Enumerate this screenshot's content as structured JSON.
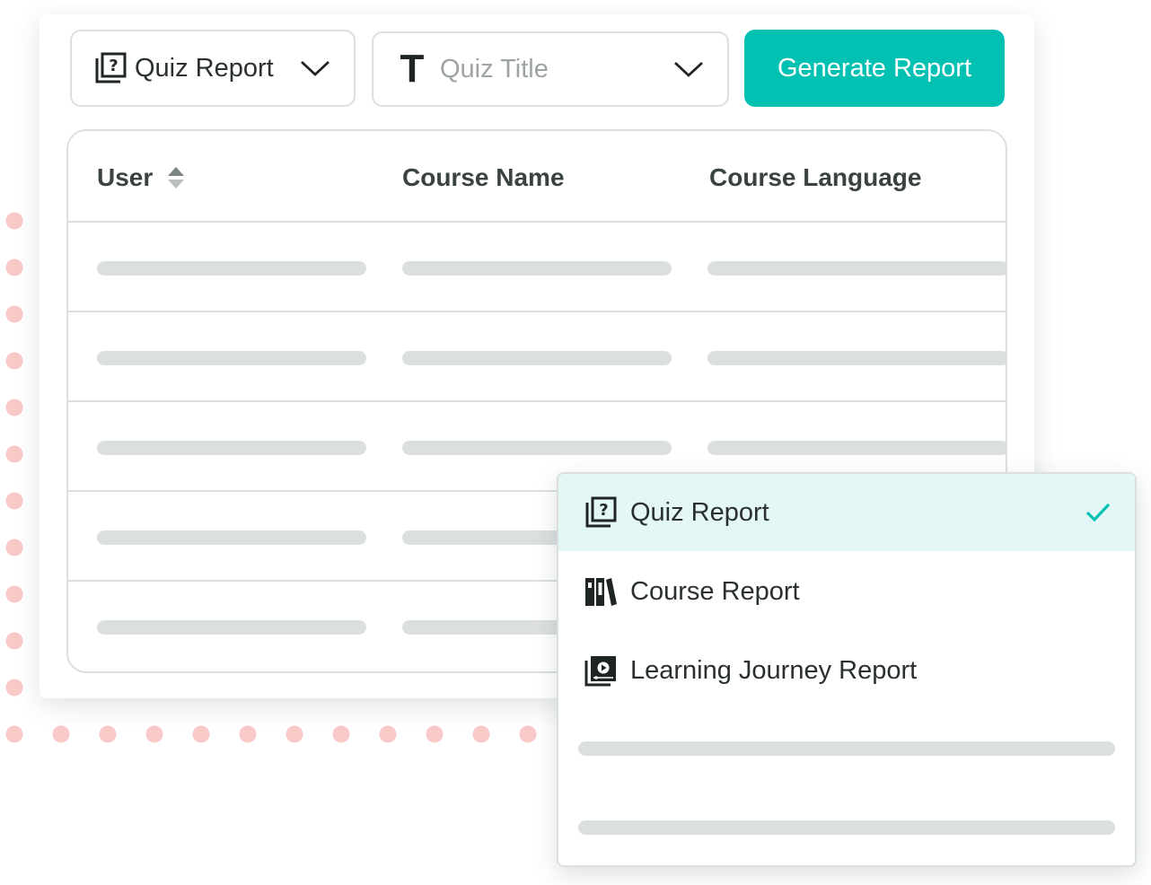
{
  "colors": {
    "accent": "#03c1b2",
    "selected_bg": "#e3f7f6",
    "dot": "#f9c9c8",
    "border": "#dcdfe0",
    "skeleton": "#dcdfe0"
  },
  "toolbar": {
    "report_type": {
      "icon": "quiz-report-icon",
      "value": "Quiz Report"
    },
    "quiz_title": {
      "icon": "text-icon",
      "placeholder": "Quiz Title"
    },
    "generate_label": "Generate Report"
  },
  "table": {
    "columns": [
      {
        "label": "User",
        "sortable": true
      },
      {
        "label": "Course Name",
        "sortable": false
      },
      {
        "label": "Course Language",
        "sortable": false
      }
    ]
  },
  "report_menu": {
    "items": [
      {
        "label": "Quiz Report",
        "icon": "quiz-report-icon",
        "selected": true
      },
      {
        "label": "Course Report",
        "icon": "books-icon",
        "selected": false
      },
      {
        "label": "Learning Journey Report",
        "icon": "video-library-icon",
        "selected": false
      }
    ]
  }
}
